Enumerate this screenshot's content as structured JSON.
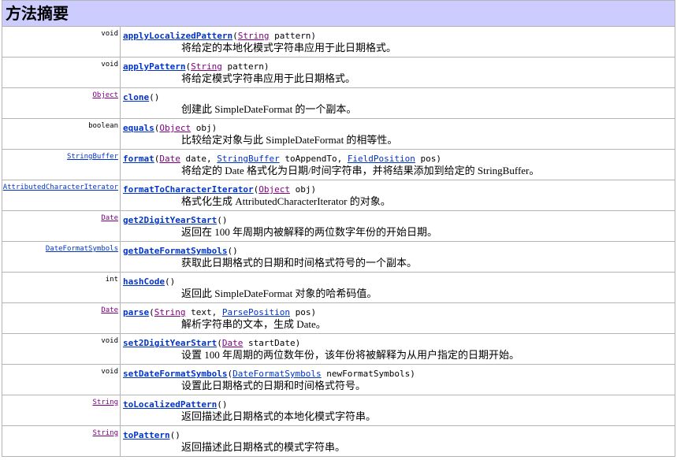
{
  "section_title": "方法摘要",
  "colors": {
    "header_bg": "#CCCCFF",
    "link": "#0033CC",
    "visited_link": "#800080",
    "border": "#B4B4B4",
    "text": "#000000"
  },
  "methods": [
    {
      "return_type": {
        "text": "void"
      },
      "name": "applyLocalizedPattern",
      "signature": [
        {
          "text": "("
        },
        {
          "text": "String",
          "link": true,
          "visited": true
        },
        {
          "text": " pattern)"
        }
      ],
      "description": "将给定的本地化模式字符串应用于此日期格式。"
    },
    {
      "return_type": {
        "text": "void"
      },
      "name": "applyPattern",
      "signature": [
        {
          "text": "("
        },
        {
          "text": "String",
          "link": true,
          "visited": true
        },
        {
          "text": " pattern)"
        }
      ],
      "description": "将给定模式字符串应用于此日期格式。"
    },
    {
      "return_type": {
        "text": "Object",
        "link": true,
        "visited": true
      },
      "name": "clone",
      "signature": [
        {
          "text": "()"
        }
      ],
      "description": "创建此 SimpleDateFormat 的一个副本。"
    },
    {
      "return_type": {
        "text": "boolean"
      },
      "name": "equals",
      "signature": [
        {
          "text": "("
        },
        {
          "text": "Object",
          "link": true,
          "visited": true
        },
        {
          "text": " obj)"
        }
      ],
      "description": "比较给定对象与此 SimpleDateFormat 的相等性。"
    },
    {
      "return_type": {
        "text": "StringBuffer",
        "link": true,
        "visited": false
      },
      "name": "format",
      "signature": [
        {
          "text": "("
        },
        {
          "text": "Date",
          "link": true,
          "visited": true
        },
        {
          "text": " date, "
        },
        {
          "text": "StringBuffer",
          "link": true,
          "visited": false
        },
        {
          "text": " toAppendTo, "
        },
        {
          "text": "FieldPosition",
          "link": true,
          "visited": false
        },
        {
          "text": " pos)"
        }
      ],
      "description": "将给定的 Date 格式化为日期/时间字符串，并将结果添加到给定的 StringBuffer。"
    },
    {
      "return_type": {
        "text": "AttributedCharacterIterator",
        "link": true,
        "visited": false
      },
      "name": "formatToCharacterIterator",
      "signature": [
        {
          "text": "("
        },
        {
          "text": "Object",
          "link": true,
          "visited": true
        },
        {
          "text": " obj)"
        }
      ],
      "description": "格式化生成 AttributedCharacterIterator 的对象。"
    },
    {
      "return_type": {
        "text": "Date",
        "link": true,
        "visited": true
      },
      "name": "get2DigitYearStart",
      "signature": [
        {
          "text": "()"
        }
      ],
      "description": "返回在 100 年周期内被解释的两位数字年份的开始日期。"
    },
    {
      "return_type": {
        "text": "DateFormatSymbols",
        "link": true,
        "visited": false
      },
      "name": "getDateFormatSymbols",
      "signature": [
        {
          "text": "()"
        }
      ],
      "description": "获取此日期格式的日期和时间格式符号的一个副本。"
    },
    {
      "return_type": {
        "text": "int"
      },
      "name": "hashCode",
      "signature": [
        {
          "text": "()"
        }
      ],
      "description": "返回此 SimpleDateFormat 对象的哈希码值。"
    },
    {
      "return_type": {
        "text": "Date",
        "link": true,
        "visited": true
      },
      "name": "parse",
      "signature": [
        {
          "text": "("
        },
        {
          "text": "String",
          "link": true,
          "visited": true
        },
        {
          "text": " text, "
        },
        {
          "text": "ParsePosition",
          "link": true,
          "visited": false
        },
        {
          "text": " pos)"
        }
      ],
      "description": "解析字符串的文本，生成 Date。"
    },
    {
      "return_type": {
        "text": "void"
      },
      "name": "set2DigitYearStart",
      "signature": [
        {
          "text": "("
        },
        {
          "text": "Date",
          "link": true,
          "visited": true
        },
        {
          "text": " startDate)"
        }
      ],
      "description": "设置 100 年周期的两位数年份，该年份将被解释为从用户指定的日期开始。"
    },
    {
      "return_type": {
        "text": "void"
      },
      "name": "setDateFormatSymbols",
      "signature": [
        {
          "text": "("
        },
        {
          "text": "DateFormatSymbols",
          "link": true,
          "visited": false
        },
        {
          "text": " newFormatSymbols)"
        }
      ],
      "description": "设置此日期格式的日期和时间格式符号。"
    },
    {
      "return_type": {
        "text": "String",
        "link": true,
        "visited": true
      },
      "name": "toLocalizedPattern",
      "signature": [
        {
          "text": "()"
        }
      ],
      "description": "返回描述此日期格式的本地化模式字符串。"
    },
    {
      "return_type": {
        "text": "String",
        "link": true,
        "visited": true
      },
      "name": "toPattern",
      "signature": [
        {
          "text": "()"
        }
      ],
      "description": "返回描述此日期格式的模式字符串。"
    }
  ]
}
